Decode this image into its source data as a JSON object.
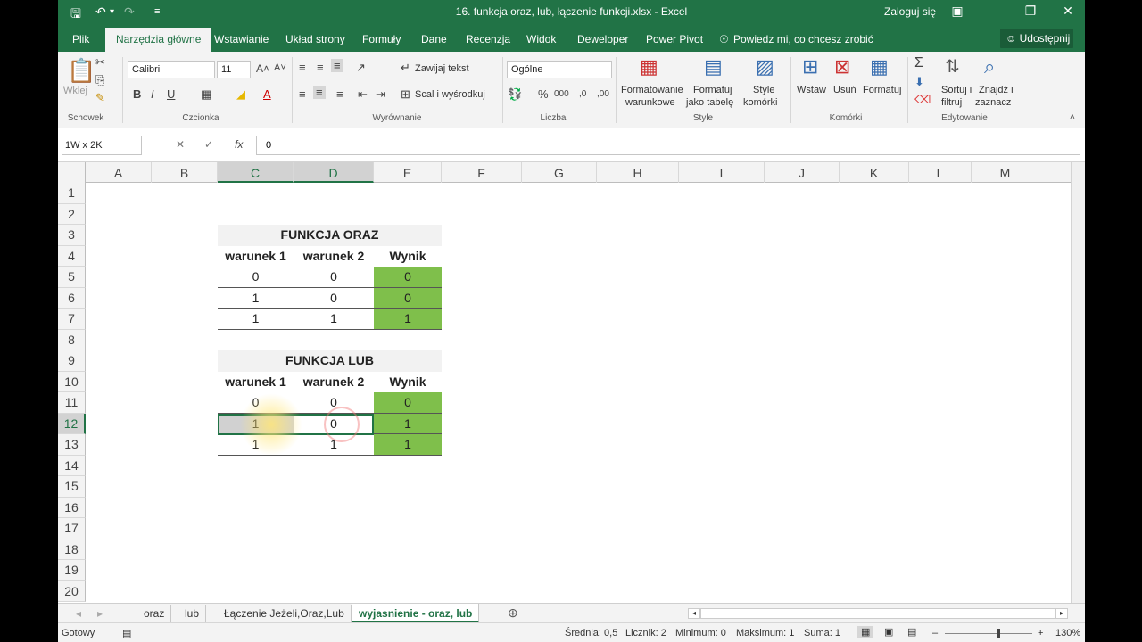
{
  "window": {
    "title": "16. funkcja oraz, lub, łączenie funkcji.xlsx - Excel",
    "login": "Zaloguj się"
  },
  "tabs": [
    "Plik",
    "Narzędzia główne",
    "Wstawianie",
    "Układ strony",
    "Formuły",
    "Dane",
    "Recenzja",
    "Widok",
    "Deweloper",
    "Power Pivot"
  ],
  "tell_me": "Powiedz mi, co chcesz zrobić",
  "share": "Udostępnij",
  "ribbon": {
    "clipboard": {
      "paste": "Wklej",
      "label": "Schowek"
    },
    "font": {
      "name": "Calibri",
      "size": "11",
      "label": "Czcionka"
    },
    "alignment": {
      "wrap": "Zawijaj tekst",
      "merge": "Scal i wyśrodkuj",
      "label": "Wyrównanie"
    },
    "number": {
      "format": "Ogólne",
      "label": "Liczba"
    },
    "styles": {
      "conditional_1": "Formatowanie",
      "conditional_2": "warunkowe",
      "table_1": "Formatuj",
      "table_2": "jako tabelę",
      "cell_1": "Style",
      "cell_2": "komórki",
      "label": "Style"
    },
    "cells": {
      "insert": "Wstaw",
      "delete": "Usuń",
      "format": "Formatuj",
      "label": "Komórki"
    },
    "editing": {
      "sort_1": "Sortuj i",
      "sort_2": "filtruj",
      "find_1": "Znajdź i",
      "find_2": "zaznacz",
      "label": "Edytowanie"
    }
  },
  "formula_bar": {
    "name_box": "1W x 2K",
    "value": "0"
  },
  "columns": [
    "A",
    "B",
    "C",
    "D",
    "E",
    "F",
    "G",
    "H",
    "I",
    "J",
    "K",
    "L",
    "M"
  ],
  "rows": [
    "1",
    "2",
    "3",
    "4",
    "5",
    "6",
    "7",
    "8",
    "9",
    "10",
    "11",
    "12",
    "13",
    "14",
    "15",
    "16",
    "17",
    "18",
    "19",
    "20"
  ],
  "table_oraz": {
    "title": "FUNKCJA ORAZ",
    "headers": [
      "warunek 1",
      "warunek 2",
      "Wynik"
    ],
    "rows": [
      [
        "0",
        "0",
        "0"
      ],
      [
        "1",
        "0",
        "0"
      ],
      [
        "1",
        "1",
        "1"
      ]
    ]
  },
  "table_lub": {
    "title": "FUNKCJA LUB",
    "headers": [
      "warunek 1",
      "warunek 2",
      "Wynik"
    ],
    "rows": [
      [
        "0",
        "0",
        "0"
      ],
      [
        "1",
        "0",
        "1"
      ],
      [
        "1",
        "1",
        "1"
      ]
    ]
  },
  "sheets": [
    "oraz",
    "lub",
    "Łączenie Jeżeli,Oraz,Lub",
    "wyjasnienie - oraz, lub"
  ],
  "status": {
    "ready": "Gotowy",
    "average": "Średnia: 0,5",
    "count": "Licznik: 2",
    "min": "Minimum: 0",
    "max": "Maksimum: 1",
    "sum": "Suma: 1",
    "zoom": "130%"
  },
  "colors": {
    "accent": "#217346",
    "green_fill": "#7fbf4b",
    "header_fill": "#f2f2f2"
  }
}
